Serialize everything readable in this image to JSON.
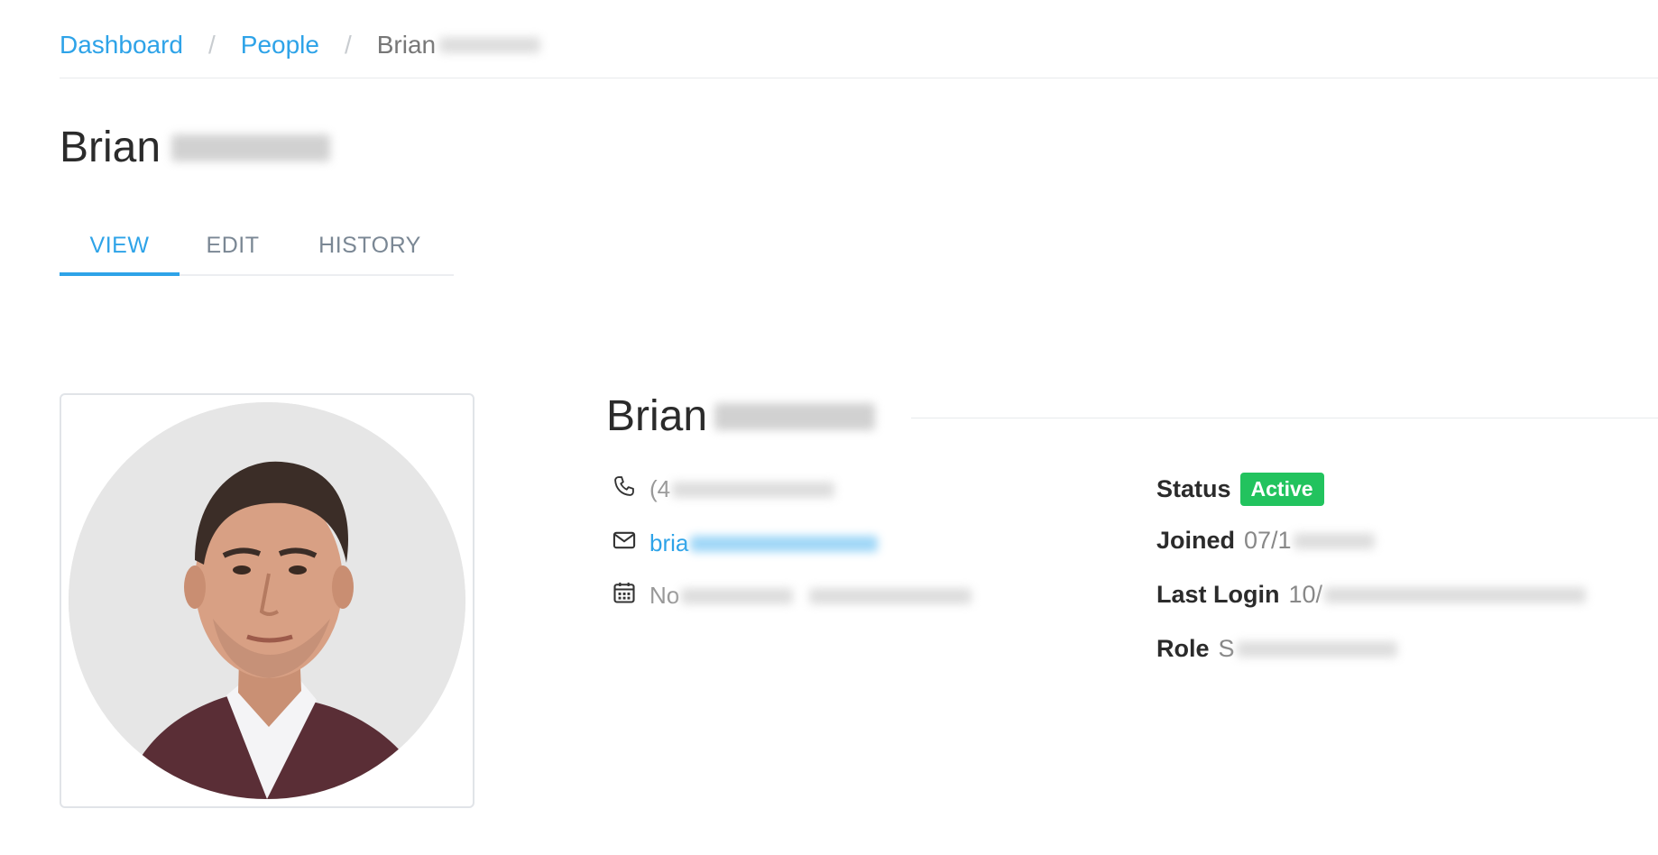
{
  "breadcrumb": {
    "items": [
      {
        "label": "Dashboard"
      },
      {
        "label": "People"
      }
    ],
    "separator": "/",
    "current": "Brian"
  },
  "page_title": {
    "first_name": "Brian"
  },
  "tabs": [
    {
      "label": "VIEW",
      "active": true
    },
    {
      "label": "EDIT",
      "active": false
    },
    {
      "label": "HISTORY",
      "active": false
    }
  ],
  "profile": {
    "first_name": "Brian",
    "phone_prefix": "(4",
    "email_prefix": "bria",
    "dob_prefix": "No",
    "phone_icon": "phone-icon",
    "email_icon": "envelope-icon",
    "dob_icon": "calendar-icon"
  },
  "details": {
    "status_label": "Status",
    "status_value": "Active",
    "joined_label": "Joined",
    "joined_value_prefix": "07/1",
    "last_login_label": "Last Login",
    "last_login_value_prefix": "10/",
    "role_label": "Role",
    "role_value_prefix": "S"
  },
  "colors": {
    "link": "#2ea3e8",
    "active_badge": "#22c35e",
    "tab_inactive": "#7a8794"
  }
}
